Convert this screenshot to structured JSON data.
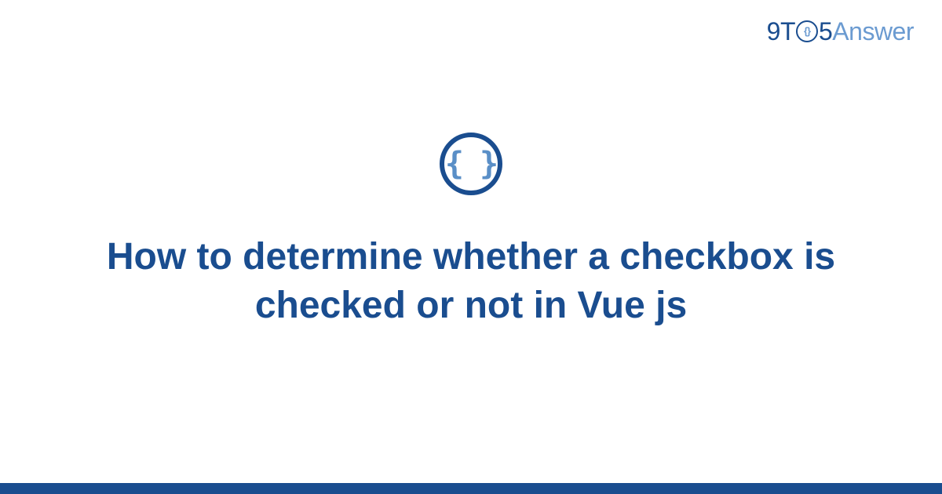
{
  "brand": {
    "part1": "9T",
    "part2": "5",
    "part3": "Answer",
    "circle_inner": "{}"
  },
  "icon": {
    "braces": "{ }"
  },
  "title": "How to determine whether a checkbox is checked or not in Vue js",
  "colors": {
    "primary": "#1a4d8f",
    "secondary": "#6b9bd1"
  }
}
